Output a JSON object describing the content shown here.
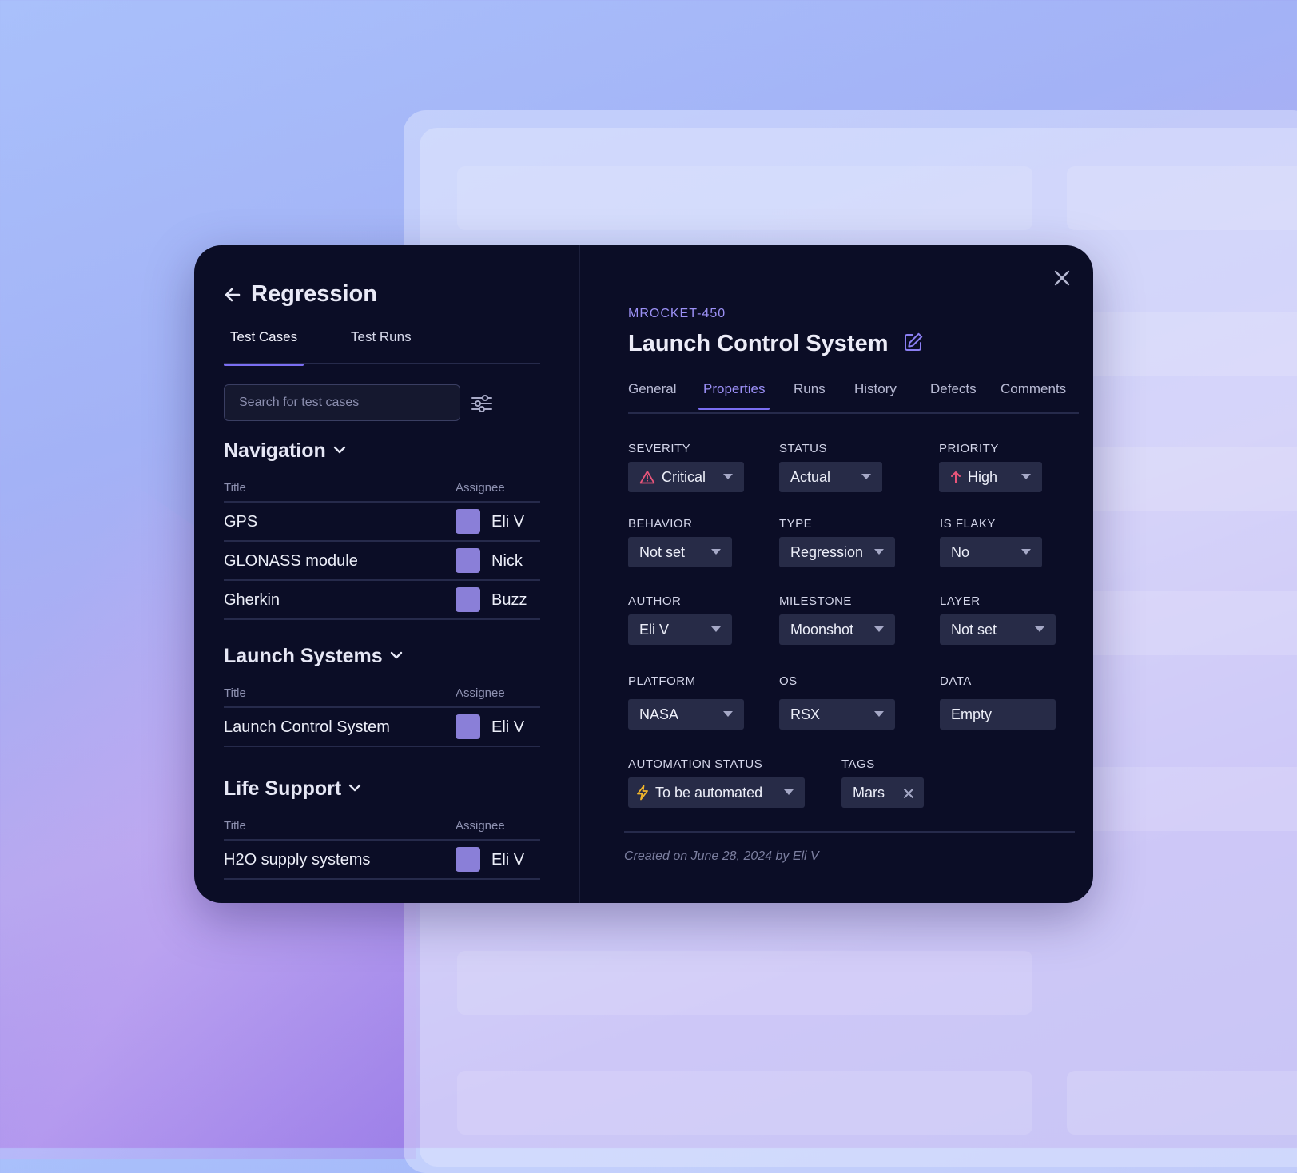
{
  "left": {
    "title": "Regression",
    "tabs": [
      {
        "label": "Test Cases",
        "active": true
      },
      {
        "label": "Test Runs",
        "active": false
      }
    ],
    "search": {
      "placeholder": "Search for test cases",
      "value": ""
    },
    "column_headers": {
      "title": "Title",
      "assignee": "Assignee"
    },
    "groups": [
      {
        "name": "Navigation",
        "rows": [
          {
            "title": "GPS",
            "assignee": "Eli V"
          },
          {
            "title": "GLONASS module",
            "assignee": "Nick"
          },
          {
            "title": "Gherkin",
            "assignee": "Buzz"
          }
        ]
      },
      {
        "name": "Launch Systems",
        "rows": [
          {
            "title": "Launch Control System",
            "assignee": "Eli V"
          }
        ]
      },
      {
        "name": "Life Support",
        "rows": [
          {
            "title": "H2O supply systems",
            "assignee": "Eli V"
          }
        ]
      }
    ]
  },
  "right": {
    "case_id": "MROCKET-450",
    "case_title": "Launch Control System",
    "tabs": [
      {
        "label": "General",
        "active": false
      },
      {
        "label": "Properties",
        "active": true
      },
      {
        "label": "Runs",
        "active": false
      },
      {
        "label": "History",
        "active": false
      },
      {
        "label": "Defects",
        "active": false
      },
      {
        "label": "Comments",
        "active": false
      }
    ],
    "properties": {
      "severity": {
        "label": "SEVERITY",
        "value": "Critical",
        "icon": "warning-triangle-icon"
      },
      "status": {
        "label": "STATUS",
        "value": "Actual"
      },
      "priority": {
        "label": "PRIORITY",
        "value": "High",
        "icon": "arrow-up-icon"
      },
      "behavior": {
        "label": "BEHAVIOR",
        "value": "Not set"
      },
      "type": {
        "label": "TYPE",
        "value": "Regression"
      },
      "is_flaky": {
        "label": "IS FLAKY",
        "value": "No"
      },
      "author": {
        "label": "AUTHOR",
        "value": "Eli V"
      },
      "milestone": {
        "label": "MILESTONE",
        "value": "Moonshot"
      },
      "layer": {
        "label": "LAYER",
        "value": "Not set"
      },
      "platform": {
        "label": "PLATFORM",
        "value": "NASA"
      },
      "os": {
        "label": "OS",
        "value": "RSX"
      },
      "data": {
        "label": "DATA",
        "value": "Empty"
      },
      "automation_status": {
        "label": "AUTOMATION STATUS",
        "value": "To be automated",
        "icon": "lightning-icon"
      },
      "tags": {
        "label": "TAGS",
        "items": [
          "Mars"
        ]
      }
    },
    "created_note": "Created on June 28, 2024 by Eli V"
  },
  "colors": {
    "panel_bg": "#0b0d26",
    "accent": "#7b6ef2",
    "accent_text": "#9b8ff6",
    "select_bg": "#272b47",
    "severity_icon": "#e8557a",
    "priority_icon": "#e8557a",
    "automation_icon": "#f2b52b",
    "avatar": "#8a7fd8"
  }
}
